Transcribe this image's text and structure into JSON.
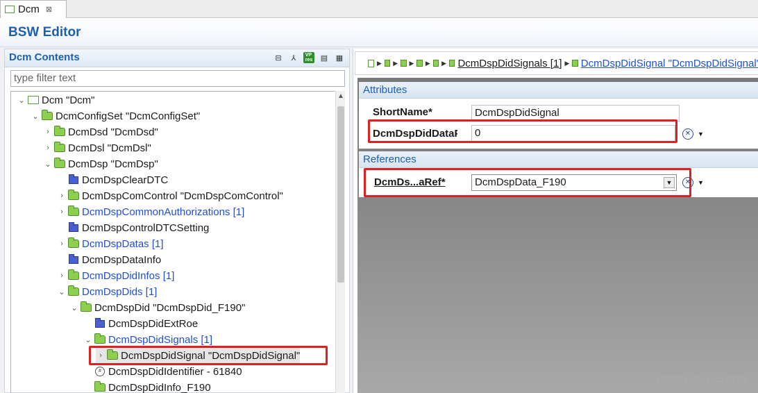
{
  "tab": {
    "label": "Dcm"
  },
  "editor": {
    "title": "BSW Editor"
  },
  "left": {
    "title": "Dcm Contents",
    "filter_placeholder": "type filter text",
    "tree": [
      {
        "label": "Dcm \"Dcm\"",
        "icon": "module-icon",
        "expander": "collapse",
        "link": false
      },
      {
        "label": "DcmConfigSet \"DcmConfigSet\"",
        "icon": "folder-icon",
        "expander": "collapse",
        "link": false
      },
      {
        "label": "DcmDsd \"DcmDsd\"",
        "icon": "folder-icon",
        "expander": "expand",
        "link": false
      },
      {
        "label": "DcmDsl \"DcmDsl\"",
        "icon": "folder-icon",
        "expander": "expand",
        "link": false
      },
      {
        "label": "DcmDsp \"DcmDsp\"",
        "icon": "folder-icon",
        "expander": "collapse",
        "link": false
      },
      {
        "label": "DcmDspClearDTC",
        "icon": "blue-folder-icon",
        "expander": "",
        "link": false
      },
      {
        "label": "DcmDspComControl \"DcmDspComControl\"",
        "icon": "folder-icon",
        "expander": "expand",
        "link": false
      },
      {
        "label": "DcmDspCommonAuthorizations [1]",
        "icon": "folder-icon",
        "expander": "expand",
        "link": true
      },
      {
        "label": "DcmDspControlDTCSetting",
        "icon": "blue-folder-icon",
        "expander": "",
        "link": false
      },
      {
        "label": "DcmDspDatas [1]",
        "icon": "folder-icon",
        "expander": "expand",
        "link": true
      },
      {
        "label": "DcmDspDataInfo",
        "icon": "blue-folder-icon",
        "expander": "",
        "link": false
      },
      {
        "label": "DcmDspDidInfos [1]",
        "icon": "folder-icon",
        "expander": "expand",
        "link": true
      },
      {
        "label": "DcmDspDids [1]",
        "icon": "folder-icon",
        "expander": "collapse",
        "link": true
      },
      {
        "label": "DcmDspDid \"DcmDspDid_F190\"",
        "icon": "folder-icon",
        "expander": "collapse",
        "link": false
      },
      {
        "label": "DcmDspDidExtRoe",
        "icon": "blue-folder-icon",
        "expander": "",
        "link": false
      },
      {
        "label": "DcmDspDidSignals [1]",
        "icon": "folder-icon",
        "expander": "collapse",
        "link": true
      },
      {
        "label": "DcmDspDidSignal \"DcmDspDidSignal\"",
        "icon": "folder-icon",
        "expander": "expand",
        "link": false,
        "selected": true
      },
      {
        "label": "DcmDspDidIdentifier - 61840",
        "icon": "integer-icon",
        "expander": "",
        "link": false
      },
      {
        "label": "DcmDspDidInfo_F190",
        "icon": "reference-icon",
        "expander": "",
        "link": false
      }
    ]
  },
  "breadcrumb": {
    "signals": "DcmDspDidSignals [1]",
    "signal": "DcmDspDidSignal \"DcmDspDidSignal\""
  },
  "attributes": {
    "header": "Attributes",
    "shortname_label": "ShortName*",
    "shortname_value": "DcmDspDidSignal",
    "pos_label": "DcmDspDidDataPos*",
    "pos_value": "0"
  },
  "references": {
    "header": "References",
    "ref_label": "DcmDs...aRef*",
    "ref_value": "DcmDspData_F190"
  },
  "watermark": "CSDN @十六宿舍"
}
